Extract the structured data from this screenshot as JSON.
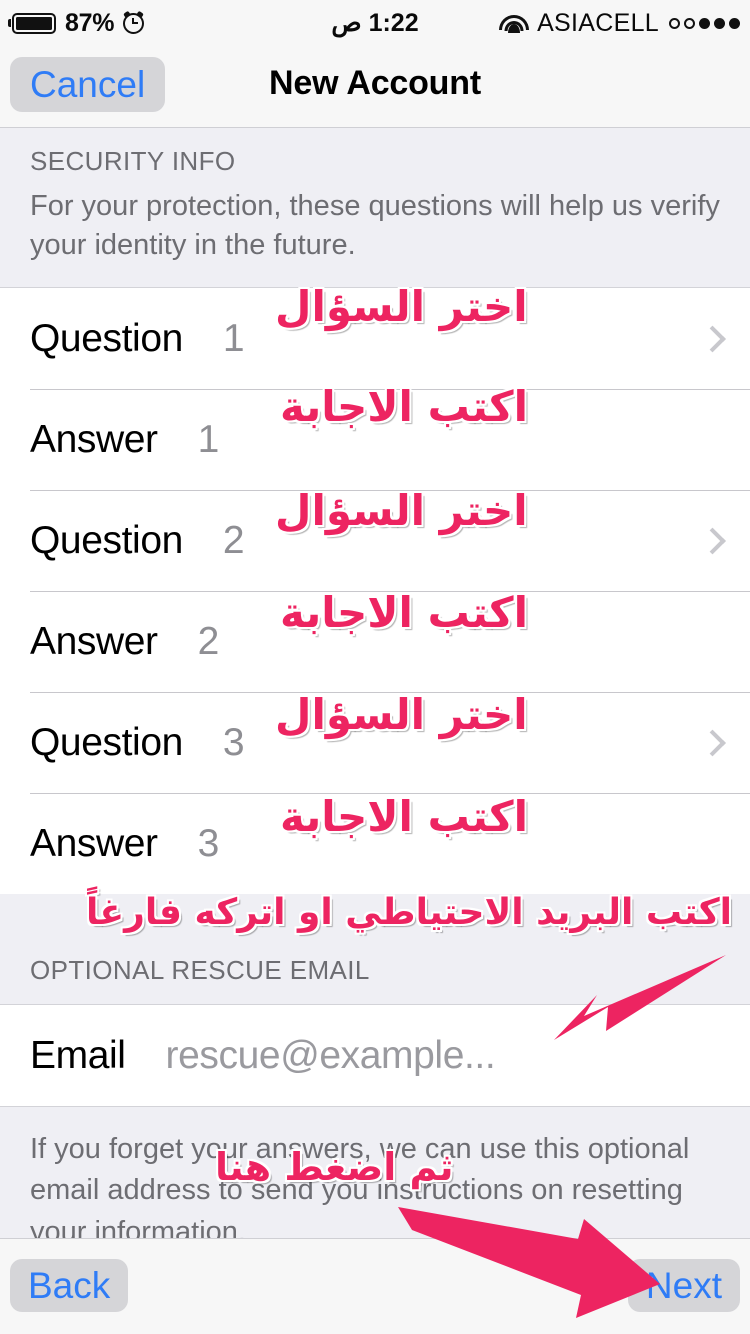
{
  "statusbar": {
    "battery_percent": "87%",
    "time": "1:22 ص",
    "carrier": "ASIACELL",
    "signal_dots": [
      "off",
      "off",
      "on",
      "on",
      "on"
    ],
    "battery_icon": "battery-icon",
    "alarm_icon": "alarm-clock-icon",
    "wifi_icon": "wifi-icon"
  },
  "navbar": {
    "cancel_label": "Cancel",
    "title": "New Account"
  },
  "security_section": {
    "header": "SECURITY INFO",
    "description": "For your protection, these questions will help us verify your identity in the future."
  },
  "rows": [
    {
      "label": "Question",
      "value": "1",
      "chevron": true
    },
    {
      "label": "Answer",
      "value": "1",
      "chevron": false
    },
    {
      "label": "Question",
      "value": "2",
      "chevron": true
    },
    {
      "label": "Answer",
      "value": "2",
      "chevron": false
    },
    {
      "label": "Question",
      "value": "3",
      "chevron": true
    },
    {
      "label": "Answer",
      "value": "3",
      "chevron": false
    }
  ],
  "rescue_section": {
    "header": "OPTIONAL RESCUE EMAIL",
    "email_label": "Email",
    "email_placeholder": "rescue@example...",
    "footer_note": "If you forget your answers, we can use this optional email address to send you instructions on resetting your information."
  },
  "toolbar": {
    "back_label": "Back",
    "next_label": "Next"
  },
  "annotations": {
    "accent_color": "#ED2461",
    "choose_question": "اختر السؤال",
    "write_answer": "اكتب الاجابة",
    "rescue_email_note": "اكتب البريد الاحتياطي او اتركه فارغاً",
    "then_press_here": "ثم اضغط هنا"
  }
}
